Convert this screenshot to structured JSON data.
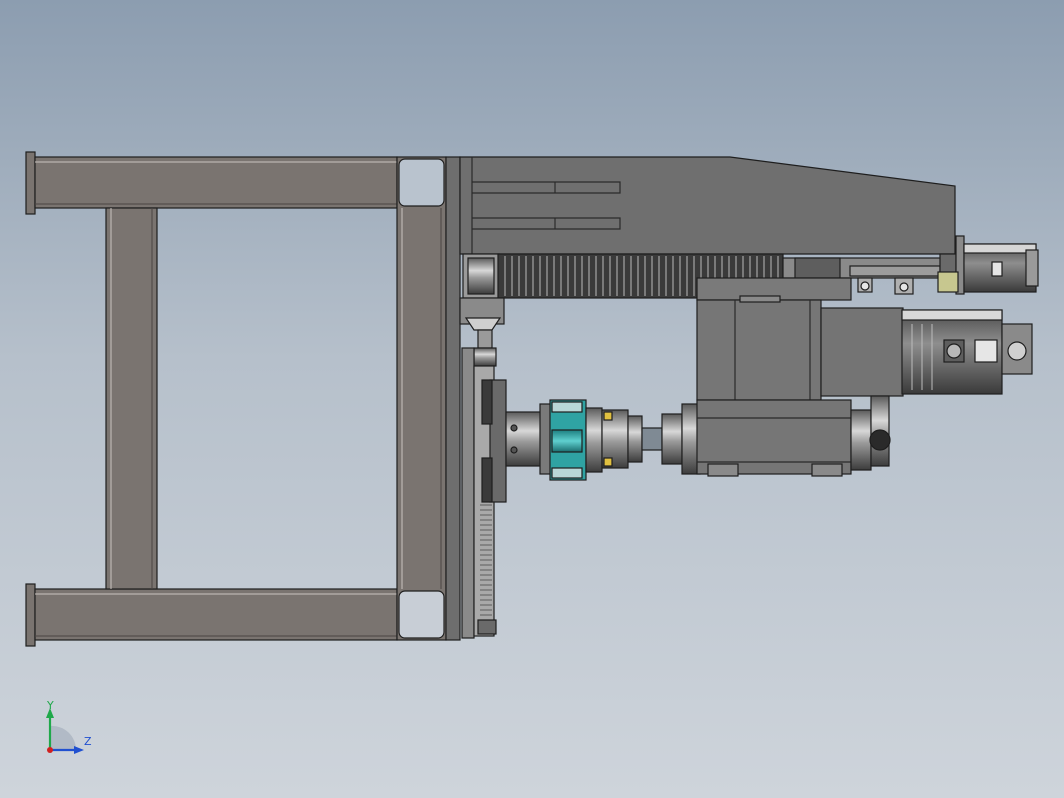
{
  "viewport": {
    "background_top": "#8c9db0",
    "background_bottom": "#ced4db"
  },
  "model": {
    "frame_color": "#7a7470",
    "gearbox_color": "#6f6f6f",
    "body_color": "#767676",
    "chuck_accent_color": "#2fa3a3",
    "outline_color": "#1e1e1e"
  },
  "triad": {
    "y_label": "Y",
    "z_label": "Z",
    "y_color": "#1fa84a",
    "z_color": "#2050d0",
    "x_color": "#d02020"
  }
}
